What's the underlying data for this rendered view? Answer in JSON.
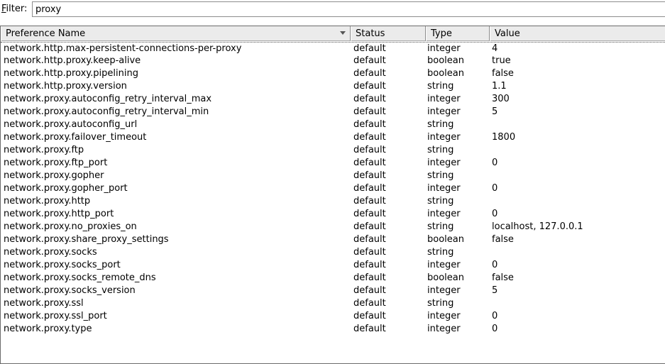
{
  "filter": {
    "label_accel": "F",
    "label_rest": "ilter:",
    "value": "proxy"
  },
  "columns": {
    "name": "Preference Name",
    "status": "Status",
    "type": "Type",
    "value": "Value"
  },
  "rows": [
    {
      "name": "network.http.max-persistent-connections-per-proxy",
      "status": "default",
      "type": "integer",
      "value": "4"
    },
    {
      "name": "network.http.proxy.keep-alive",
      "status": "default",
      "type": "boolean",
      "value": "true"
    },
    {
      "name": "network.http.proxy.pipelining",
      "status": "default",
      "type": "boolean",
      "value": "false"
    },
    {
      "name": "network.http.proxy.version",
      "status": "default",
      "type": "string",
      "value": "1.1"
    },
    {
      "name": "network.proxy.autoconfig_retry_interval_max",
      "status": "default",
      "type": "integer",
      "value": "300"
    },
    {
      "name": "network.proxy.autoconfig_retry_interval_min",
      "status": "default",
      "type": "integer",
      "value": "5"
    },
    {
      "name": "network.proxy.autoconfig_url",
      "status": "default",
      "type": "string",
      "value": ""
    },
    {
      "name": "network.proxy.failover_timeout",
      "status": "default",
      "type": "integer",
      "value": "1800"
    },
    {
      "name": "network.proxy.ftp",
      "status": "default",
      "type": "string",
      "value": ""
    },
    {
      "name": "network.proxy.ftp_port",
      "status": "default",
      "type": "integer",
      "value": "0"
    },
    {
      "name": "network.proxy.gopher",
      "status": "default",
      "type": "string",
      "value": ""
    },
    {
      "name": "network.proxy.gopher_port",
      "status": "default",
      "type": "integer",
      "value": "0"
    },
    {
      "name": "network.proxy.http",
      "status": "default",
      "type": "string",
      "value": ""
    },
    {
      "name": "network.proxy.http_port",
      "status": "default",
      "type": "integer",
      "value": "0"
    },
    {
      "name": "network.proxy.no_proxies_on",
      "status": "default",
      "type": "string",
      "value": "localhost, 127.0.0.1"
    },
    {
      "name": "network.proxy.share_proxy_settings",
      "status": "default",
      "type": "boolean",
      "value": "false"
    },
    {
      "name": "network.proxy.socks",
      "status": "default",
      "type": "string",
      "value": ""
    },
    {
      "name": "network.proxy.socks_port",
      "status": "default",
      "type": "integer",
      "value": "0"
    },
    {
      "name": "network.proxy.socks_remote_dns",
      "status": "default",
      "type": "boolean",
      "value": "false"
    },
    {
      "name": "network.proxy.socks_version",
      "status": "default",
      "type": "integer",
      "value": "5"
    },
    {
      "name": "network.proxy.ssl",
      "status": "default",
      "type": "string",
      "value": ""
    },
    {
      "name": "network.proxy.ssl_port",
      "status": "default",
      "type": "integer",
      "value": "0"
    },
    {
      "name": "network.proxy.type",
      "status": "default",
      "type": "integer",
      "value": "0"
    }
  ]
}
